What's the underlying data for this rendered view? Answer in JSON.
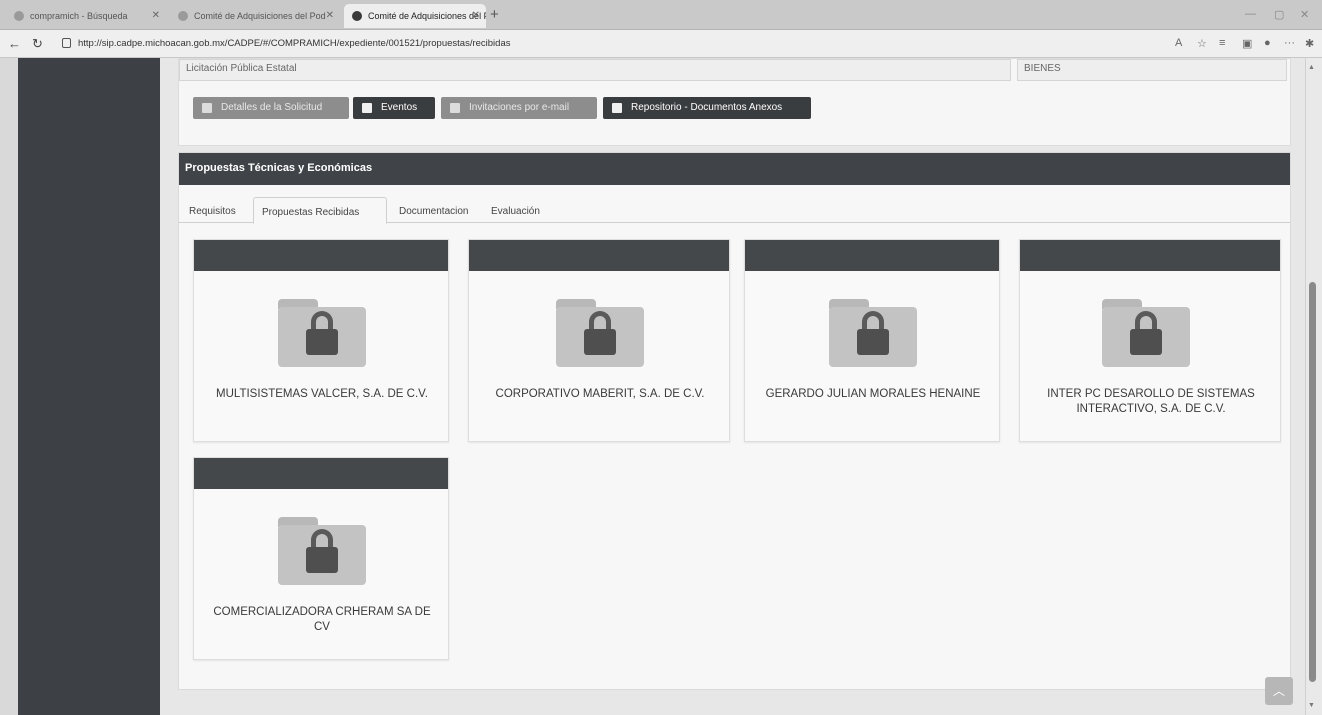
{
  "browser": {
    "tabs": [
      {
        "title": "compramich - Búsqueda"
      },
      {
        "title": "Comité de Adquisiciones del Pod"
      },
      {
        "title": "Comité de Adquisiciones del Po"
      }
    ],
    "new_tab_icon": "plus-icon",
    "url": "http://sip.cadpe.michoacan.gob.mx/CADPE/#/COMPRAMICH/expediente/001521/propuestas/recibidas"
  },
  "info": {
    "tipo": "Licitación Pública Estatal",
    "categoria": "BIENES"
  },
  "actions": {
    "detalles": "Detalles de la Solicitud",
    "eventos": "Eventos",
    "invitaciones": "Invitaciones por e-mail",
    "repositorio": "Repositorio - Documentos Anexos"
  },
  "panel": {
    "title": "Propuestas Técnicas y Económicas",
    "tabs": [
      {
        "label": "Requisitos"
      },
      {
        "label": "Propuestas Recibidas"
      },
      {
        "label": "Documentacion"
      },
      {
        "label": "Evaluación"
      }
    ],
    "active_tab": "Propuestas Recibidas"
  },
  "proposals": [
    {
      "name": "MULTISISTEMAS VALCER, S.A. DE C.V.",
      "icon": "locked-folder-icon"
    },
    {
      "name": "CORPORATIVO MABERIT, S.A. DE C.V.",
      "icon": "locked-folder-icon"
    },
    {
      "name": "GERARDO JULIAN MORALES HENAINE",
      "icon": "locked-folder-icon"
    },
    {
      "name": "INTER PC DESAROLLO DE SISTEMAS INTERACTIVO, S.A. DE C.V.",
      "icon": "locked-folder-icon"
    },
    {
      "name": "COMERCIALIZADORA CRHERAM SA DE CV",
      "icon": "locked-folder-icon"
    }
  ],
  "colors": {
    "sidebar": "#3d4044",
    "header_dark": "#404448",
    "card_header": "#45484b"
  }
}
